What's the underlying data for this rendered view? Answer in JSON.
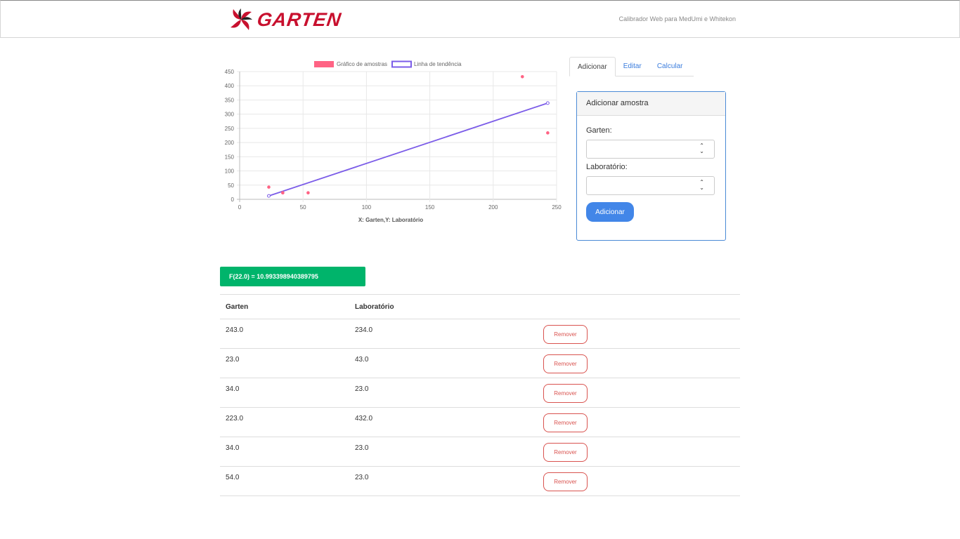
{
  "header": {
    "brand": "GARTEN",
    "subtitle": "Calibrador Web para MedUmi e Whitekon"
  },
  "tabs": [
    {
      "label": "Adicionar"
    },
    {
      "label": "Editar"
    },
    {
      "label": "Calcular"
    }
  ],
  "form": {
    "title": "Adicionar amostra",
    "garten_label": "Garten:",
    "lab_label": "Laboratório:",
    "garten_value": "",
    "lab_value": "",
    "submit_label": "Adicionar"
  },
  "result": "F(22.0) = 10.993398940389795",
  "table": {
    "headers": [
      "Garten",
      "Laboratório",
      ""
    ],
    "remove_label": "Remover",
    "rows": [
      {
        "garten": "243.0",
        "lab": "234.0"
      },
      {
        "garten": "23.0",
        "lab": "43.0"
      },
      {
        "garten": "34.0",
        "lab": "23.0"
      },
      {
        "garten": "223.0",
        "lab": "432.0"
      },
      {
        "garten": "34.0",
        "lab": "23.0"
      },
      {
        "garten": "54.0",
        "lab": "23.0"
      }
    ]
  },
  "colors": {
    "samples": "#ff6384",
    "trend": "#7b5ce8",
    "accent": "#4286e8",
    "success": "#00b46b",
    "danger": "#d9534f"
  },
  "chart_data": {
    "type": "scatter",
    "xlabel": "X: Garten,Y: Laboratório",
    "xlim": [
      0,
      250
    ],
    "ylim": [
      0,
      450
    ],
    "xticks": [
      0,
      50,
      100,
      150,
      200,
      250
    ],
    "yticks": [
      0,
      50,
      100,
      150,
      200,
      250,
      300,
      350,
      400,
      450
    ],
    "legend_position": "top",
    "grid": true,
    "series": [
      {
        "name": "Gráfico de amostras",
        "kind": "scatter",
        "points": [
          [
            243,
            234
          ],
          [
            23,
            43
          ],
          [
            34,
            23
          ],
          [
            223,
            432
          ],
          [
            34,
            23
          ],
          [
            54,
            23
          ]
        ]
      },
      {
        "name": "Linha de tendência",
        "kind": "line",
        "points": [
          [
            23,
            12
          ],
          [
            243,
            339
          ]
        ]
      }
    ]
  }
}
